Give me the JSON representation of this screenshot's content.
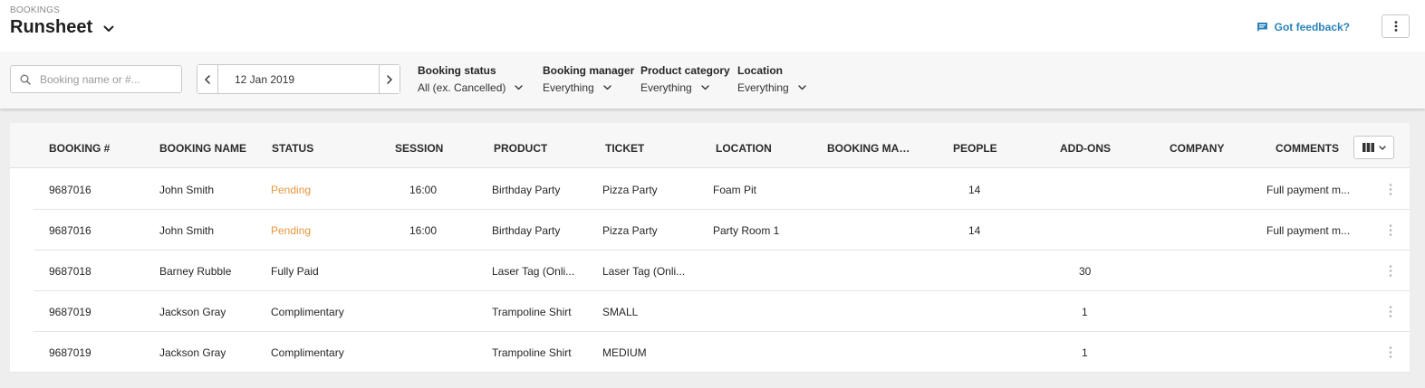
{
  "header": {
    "section": "BOOKINGS",
    "title": "Runsheet",
    "feedback_label": "Got feedback?",
    "accent_color": "#2a83b8"
  },
  "filters": {
    "search_placeholder": "Booking name or #...",
    "date": "12 Jan 2019",
    "booking_status": {
      "label": "Booking status",
      "value": "All (ex. Cancelled)"
    },
    "booking_manager": {
      "label": "Booking manager",
      "value": "Everything"
    },
    "product_category": {
      "label": "Product category",
      "value": "Everything"
    },
    "location": {
      "label": "Location",
      "value": "Everything"
    }
  },
  "table": {
    "columns": [
      "BOOKING #",
      "BOOKING NAME",
      "STATUS",
      "SESSION",
      "PRODUCT",
      "TICKET",
      "LOCATION",
      "BOOKING MAN...",
      "PEOPLE",
      "ADD-ONS",
      "COMPANY",
      "COMMENTS"
    ],
    "rows": [
      {
        "booking": "9687016",
        "name": "John Smith",
        "status": "Pending",
        "session": "16:00",
        "product": "Birthday Party",
        "ticket": "Pizza Party",
        "location": "Foam Pit",
        "manager": "",
        "people": "14",
        "addons": "",
        "company": "",
        "comments": "Full payment m..."
      },
      {
        "booking": "9687016",
        "name": "John Smith",
        "status": "Pending",
        "session": "16:00",
        "product": "Birthday Party",
        "ticket": "Pizza Party",
        "location": "Party Room 1",
        "manager": "",
        "people": "14",
        "addons": "",
        "company": "",
        "comments": "Full payment m..."
      },
      {
        "booking": "9687018",
        "name": "Barney Rubble",
        "status": "Fully Paid",
        "session": "",
        "product": "Laser Tag (Onli...",
        "ticket": "Laser Tag (Onli...",
        "location": "",
        "manager": "",
        "people": "",
        "addons": "30",
        "company": "",
        "comments": ""
      },
      {
        "booking": "9687019",
        "name": "Jackson Gray",
        "status": "Complimentary",
        "session": "",
        "product": "Trampoline Shirt",
        "ticket": "SMALL",
        "location": "",
        "manager": "",
        "people": "",
        "addons": "1",
        "company": "",
        "comments": ""
      },
      {
        "booking": "9687019",
        "name": "Jackson Gray",
        "status": "Complimentary",
        "session": "",
        "product": "Trampoline Shirt",
        "ticket": "MEDIUM",
        "location": "",
        "manager": "",
        "people": "",
        "addons": "1",
        "company": "",
        "comments": ""
      }
    ]
  },
  "colors": {
    "pending": "#e8973a",
    "header_bg": "#ffffff",
    "filter_bg": "#f7f7f8",
    "page_bg": "#eeeeee"
  },
  "icons": {
    "title_dropdown": "chevron-down-icon",
    "feedback": "chat-bubble-icon",
    "more": "kebab-icon",
    "search": "search-icon",
    "prev": "chevron-left-icon",
    "next": "chevron-right-icon",
    "columns": "columns-icon"
  }
}
